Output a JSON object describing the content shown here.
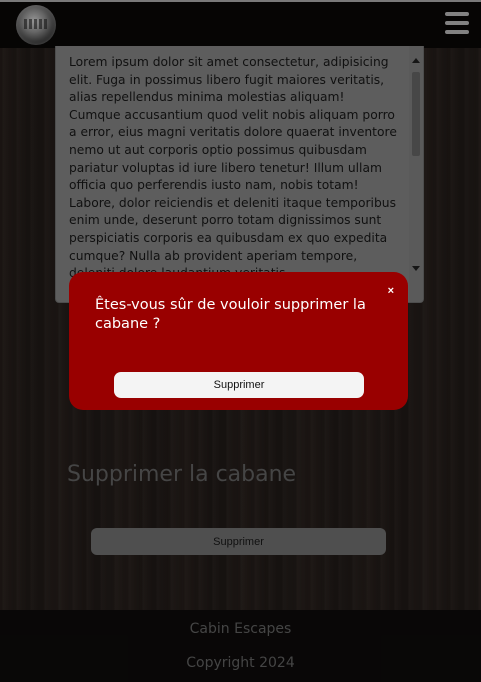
{
  "header": {
    "logo": "cabin-escapes-logo",
    "menu_icon": "hamburger-menu-icon"
  },
  "textarea": {
    "value": "Lorem ipsum dolor sit amet consectetur, adipisicing elit. Fuga in possimus libero fugit maiores veritatis, alias repellendus minima molestias aliquam! Cumque accusantium quod velit nobis aliquam porro a error, eius magni veritatis dolore quaerat inventore nemo ut aut corporis optio possimus quibusdam pariatur voluptas id iure libero tenetur! Illum ullam officia quo perferendis iusto nam, nobis totam! Labore, dolor reiciendis et deleniti itaque temporibus enim unde, deserunt porro totam dignissimos sunt perspiciatis corporis ea quibusdam ex quo expedita cumque? Nulla ab provident aperiam tempore, deleniti dolore laudantium veritatis"
  },
  "delete_section": {
    "title": "Supprimer la cabane",
    "button_label": "Supprimer"
  },
  "footer": {
    "brand": "Cabin Escapes",
    "copyright": "Copyright 2024"
  },
  "modal": {
    "message": "Êtes-vous sûr de vouloir supprimer la cabane ?",
    "close_label": "×",
    "confirm_label": "Supprimer",
    "background_color": "#990000"
  }
}
